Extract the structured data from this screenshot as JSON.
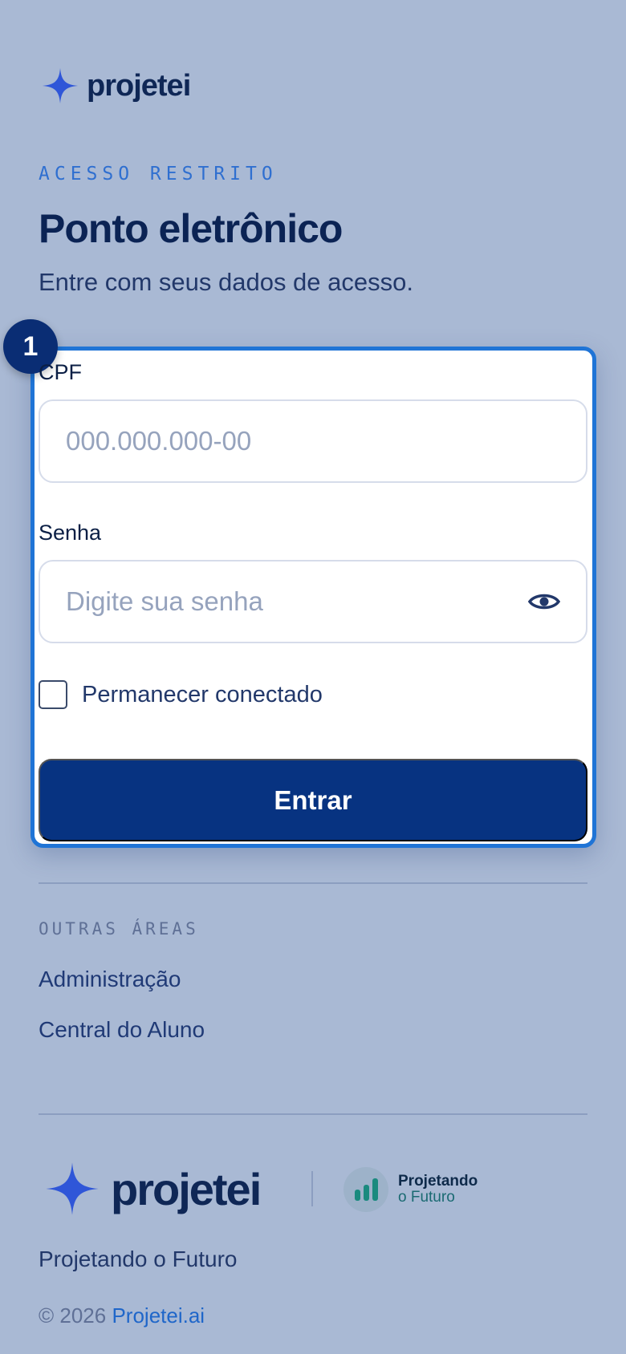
{
  "brand": {
    "name": "projetei"
  },
  "header": {
    "eyebrow": "ACESSO RESTRITO",
    "title": "Ponto eletrônico",
    "subtitle": "Entre com seus dados de acesso."
  },
  "form": {
    "step_badge": "1",
    "cpf": {
      "label": "CPF",
      "placeholder": "000.000.000-00",
      "value": ""
    },
    "senha": {
      "label": "Senha",
      "placeholder": "Digite sua senha",
      "value": ""
    },
    "remember": {
      "label": "Permanecer conectado",
      "checked": false
    },
    "submit_label": "Entrar"
  },
  "other_areas": {
    "title": "OUTRAS ÁREAS",
    "links": [
      "Administração",
      "Central do Aluno"
    ]
  },
  "footer": {
    "brand": "projetei",
    "partner": {
      "line1": "Projetando",
      "line2": "o Futuro"
    },
    "tagline": "Projetando o Futuro",
    "copyright_prefix": "© 2026",
    "copyright_link": "Projetei.ai"
  },
  "colors": {
    "background": "#a9b9d4",
    "primary": "#073381",
    "accent": "#1f74d6",
    "star": "#2f56d8"
  },
  "icons": {
    "logo": "sparkle-star-icon",
    "password_toggle": "eye-icon",
    "partner": "bar-chart-icon"
  }
}
